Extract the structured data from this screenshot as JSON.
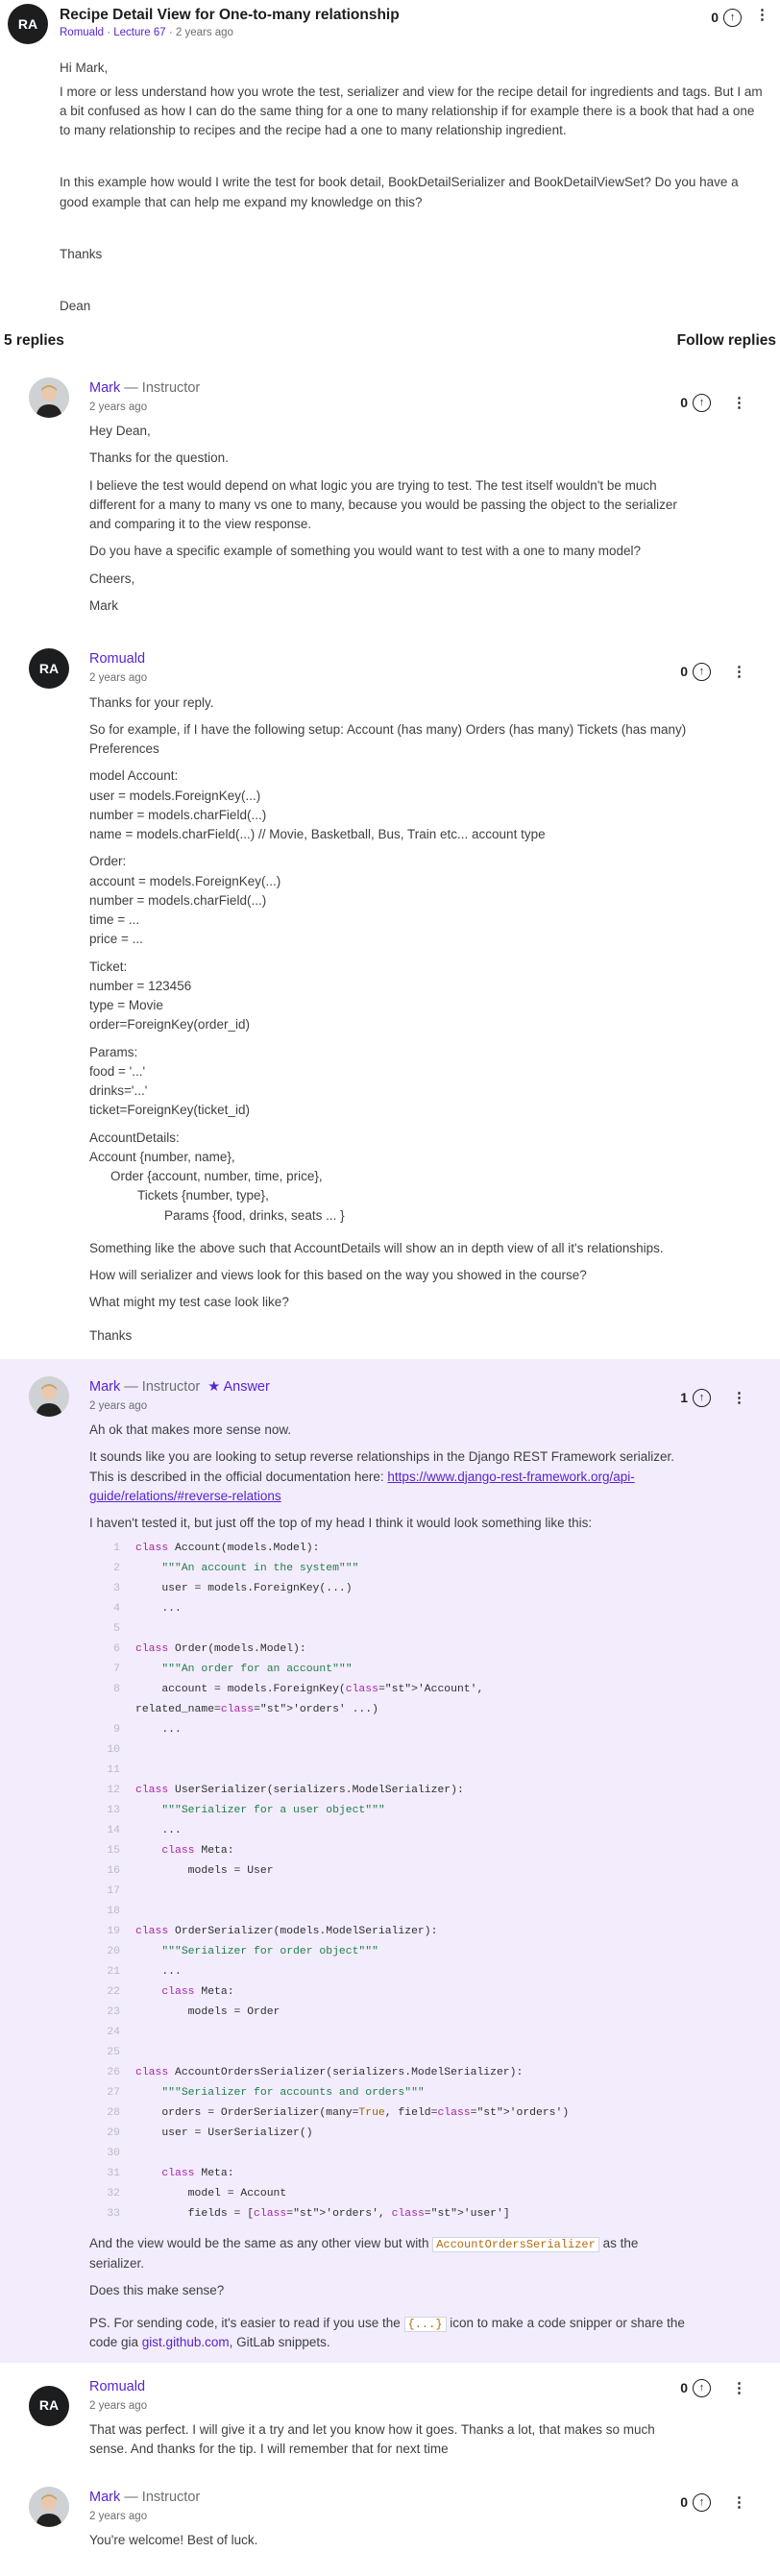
{
  "question": {
    "avatar": "RA",
    "title": "Recipe Detail View for One-to-many relationship",
    "author": "Romuald",
    "lecture": "Lecture 67",
    "time": "2 years ago",
    "votes": "0",
    "paragraphs": [
      "Hi Mark,",
      "I more or less understand how you wrote the test, serializer and view for the recipe detail for  ingredients and tags. But I am a bit confused as how I can do the same thing for a one to many relationship if for example there is a book that had a one to many relationship to recipes and the recipe had a one to many relationship ingredient.",
      "In this example how would I write the test for book detail, BookDetailSerializer and BookDetailViewSet? Do you have a good example that can help me expand my knowledge on this?",
      "Thanks",
      "Dean"
    ]
  },
  "replies_header": {
    "count": "5 replies",
    "follow": "Follow replies"
  },
  "reply1": {
    "author": "Mark",
    "role": " — Instructor",
    "time": "2 years ago",
    "votes": "0",
    "p1": "Hey Dean,",
    "p2": "Thanks for the question.",
    "p3": "I believe the test would depend on what logic you are trying to test. The test itself wouldn't be much different for a many to many vs one to many, because you would be passing the object to the serializer and comparing it to the view response.",
    "p4": "Do you have a specific example of something you would want to test with a one to many model?",
    "p5": "Cheers,",
    "p6": "Mark"
  },
  "reply2": {
    "avatar": "RA",
    "author": "Romuald",
    "time": "2 years ago",
    "votes": "0",
    "p1": "Thanks for your reply.",
    "p2": "So for example, if I have the following setup: Account (has many) Orders (has many) Tickets (has many) Preferences",
    "acc1": "model Account:",
    "acc2": "user = models.ForeignKey(...)",
    "acc3": "number = models.charField(...)",
    "acc4": "name = models.charField(...) // Movie, Basketball, Bus, Train etc... account type",
    "ord1": "Order:",
    "ord2": "account = models.ForeignKey(...)",
    "ord3": "number = models.charField(...)",
    "ord4": "time = ...",
    "ord5": "price = ...",
    "tic1": "Ticket:",
    "tic2": "number = 123456",
    "tic3": "type = Movie",
    "tic4": "order=ForeignKey(order_id)",
    "par1": "Params:",
    "par2": "food = '...'",
    "par3": "drinks='...'",
    "par4": "ticket=ForeignKey(ticket_id)",
    "det1": "AccountDetails:",
    "det2": "Account {number, name},",
    "det3": "Order {account, number, time, price},",
    "det4": "Tickets {number, type},",
    "det5": "Params {food, drinks, seats ... }",
    "p3": "Something like the above such that AccountDetails will show an in depth view of all it's relationships.",
    "p4": "How will serializer and views look for this based on the way you showed in the course?",
    "p5": "What might my test case look like?",
    "p6": "Thanks"
  },
  "reply3": {
    "author": "Mark",
    "role": " — Instructor",
    "answer_label": "Answer",
    "time": "2 years ago",
    "votes": "1",
    "p1": "Ah ok that makes more sense now.",
    "p2": "It sounds like you are looking to setup reverse relationships in the Django REST Framework serializer. This is described in the official documentation here: ",
    "p2_link": "https://www.django-rest-framework.org/api-guide/relations/#reverse-relations",
    "p3": "I haven't tested it, but just off the top of my head I think it would look something like this:",
    "p4_a": "And the view would be the same as any other view but with ",
    "p4_code": "AccountOrdersSerializer",
    "p4_b": " as the serializer.",
    "p5": "Does this make sense?",
    "p6_a": "PS. For sending code, it's easier to read if you use the ",
    "p6_code": "{...}",
    "p6_b": " icon to make a code snipper or share the code gia ",
    "p6_link": "gist.github.com",
    "p6_c": ",  GitLab snippets."
  },
  "reply4": {
    "avatar": "RA",
    "author": "Romuald",
    "time": "2 years ago",
    "votes": "0",
    "p1": "That was perfect. I will give it a try and let you know how it goes. Thanks a lot, that makes so much sense. And thanks for the tip. I will remember that for next time"
  },
  "reply5": {
    "author": "Mark",
    "role": " — Instructor",
    "time": "2 years ago",
    "votes": "0",
    "p1": "You're welcome! Best of luck."
  },
  "code_lines": [
    {
      "n": "1",
      "t": "class Account(models.Model):"
    },
    {
      "n": "2",
      "t": "    \"\"\"An account in the system\"\"\""
    },
    {
      "n": "3",
      "t": "    user = models.ForeignKey(...)"
    },
    {
      "n": "4",
      "t": "    ..."
    },
    {
      "n": "5",
      "t": ""
    },
    {
      "n": "6",
      "t": "class Order(models.Model):"
    },
    {
      "n": "7",
      "t": "    \"\"\"An order for an account\"\"\""
    },
    {
      "n": "8",
      "t": "    account = models.ForeignKey('Account', related_name='orders' ...)"
    },
    {
      "n": "9",
      "t": "    ..."
    },
    {
      "n": "10",
      "t": ""
    },
    {
      "n": "11",
      "t": ""
    },
    {
      "n": "12",
      "t": "class UserSerializer(serializers.ModelSerializer):"
    },
    {
      "n": "13",
      "t": "    \"\"\"Serializer for a user object\"\"\""
    },
    {
      "n": "14",
      "t": "    ..."
    },
    {
      "n": "15",
      "t": "    class Meta:"
    },
    {
      "n": "16",
      "t": "        models = User"
    },
    {
      "n": "17",
      "t": ""
    },
    {
      "n": "18",
      "t": ""
    },
    {
      "n": "19",
      "t": "class OrderSerializer(models.ModelSerializer):"
    },
    {
      "n": "20",
      "t": "    \"\"\"Serializer for order object\"\"\""
    },
    {
      "n": "21",
      "t": "    ..."
    },
    {
      "n": "22",
      "t": "    class Meta:"
    },
    {
      "n": "23",
      "t": "        models = Order"
    },
    {
      "n": "24",
      "t": ""
    },
    {
      "n": "25",
      "t": ""
    },
    {
      "n": "26",
      "t": "class AccountOrdersSerializer(serializers.ModelSerializer):"
    },
    {
      "n": "27",
      "t": "    \"\"\"Serializer for accounts and orders\"\"\""
    },
    {
      "n": "28",
      "t": "    orders = OrderSerializer(many=True, field='orders')"
    },
    {
      "n": "29",
      "t": "    user = UserSerializer()"
    },
    {
      "n": "30",
      "t": ""
    },
    {
      "n": "31",
      "t": "    class Meta:"
    },
    {
      "n": "32",
      "t": "        model = Account"
    },
    {
      "n": "33",
      "t": "        fields = ['orders', 'user']"
    }
  ],
  "colors": {
    "accent": "#5624d0",
    "answer_bg": "#f3ecfc",
    "text": "#1c1d1f",
    "muted": "#6a6f73"
  },
  "icons": {
    "upvote": "arrow-up-circle-icon",
    "more": "kebab-menu-icon",
    "answer": "star-icon"
  }
}
